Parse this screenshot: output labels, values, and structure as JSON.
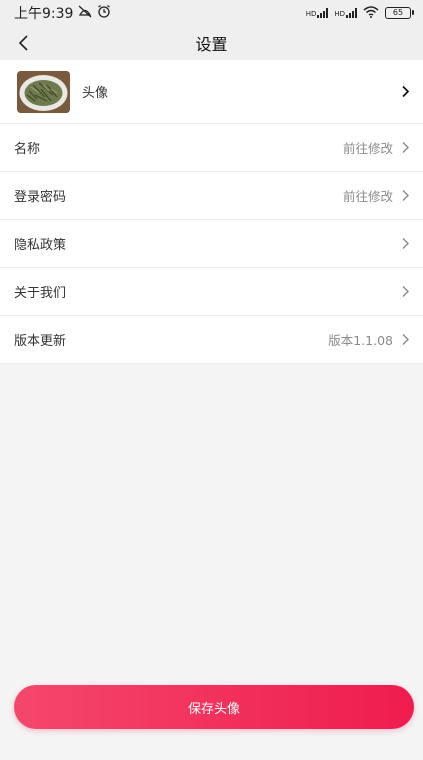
{
  "status_bar": {
    "time": "上午9:39",
    "battery": "65",
    "signal1_label": "HD",
    "signal2_label": "HD",
    "icons": [
      "no-disturb-icon",
      "alarm-icon",
      "signal-icon",
      "signal-icon",
      "wifi-icon",
      "battery-icon"
    ]
  },
  "nav": {
    "title": "设置",
    "back_icon": "chevron-left-icon"
  },
  "settings": {
    "avatar_label": "头像",
    "name_label": "名称",
    "name_value": "前往修改",
    "password_label": "登录密码",
    "password_value": "前往修改",
    "privacy_label": "隐私政策",
    "about_label": "关于我们",
    "version_label": "版本更新",
    "version_value": "版本1.1.08"
  },
  "actions": {
    "save_label": "保存头像"
  },
  "colors": {
    "accent_start": "#f4476b",
    "accent_end": "#ef1c4e",
    "header_bg": "#efefef",
    "page_bg": "#f4f4f4"
  }
}
